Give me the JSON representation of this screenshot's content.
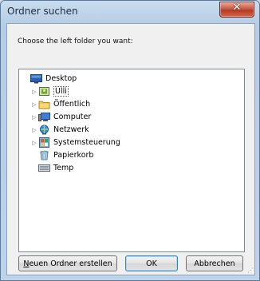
{
  "window": {
    "title": "Ordner suchen",
    "close_symbol": "✕"
  },
  "prompt": "Choose the left folder you want:",
  "tree": {
    "items": [
      {
        "label": "Desktop",
        "icon": "desktop-icon",
        "expander": ""
      },
      {
        "label": "Ulli",
        "icon": "user-folder-icon",
        "expander": "▷"
      },
      {
        "label": "Öffentlich",
        "icon": "folder-icon",
        "expander": "▷"
      },
      {
        "label": "Computer",
        "icon": "computer-icon",
        "expander": "▷"
      },
      {
        "label": "Netzwerk",
        "icon": "network-icon",
        "expander": "▷"
      },
      {
        "label": "Systemsteuerung",
        "icon": "control-panel-icon",
        "expander": "▷"
      },
      {
        "label": "Papierkorb",
        "icon": "recycle-bin-icon",
        "expander": ""
      },
      {
        "label": "Temp",
        "icon": "drive-icon",
        "expander": ""
      }
    ]
  },
  "buttons": {
    "new_folder_underline": "N",
    "new_folder_rest": "euen Ordner erstellen",
    "ok": "OK",
    "cancel": "Abbrechen"
  },
  "colors": {
    "selection_border": "#555555",
    "default_button_border": "#3c7fb1",
    "close_button": "#c85a44"
  }
}
